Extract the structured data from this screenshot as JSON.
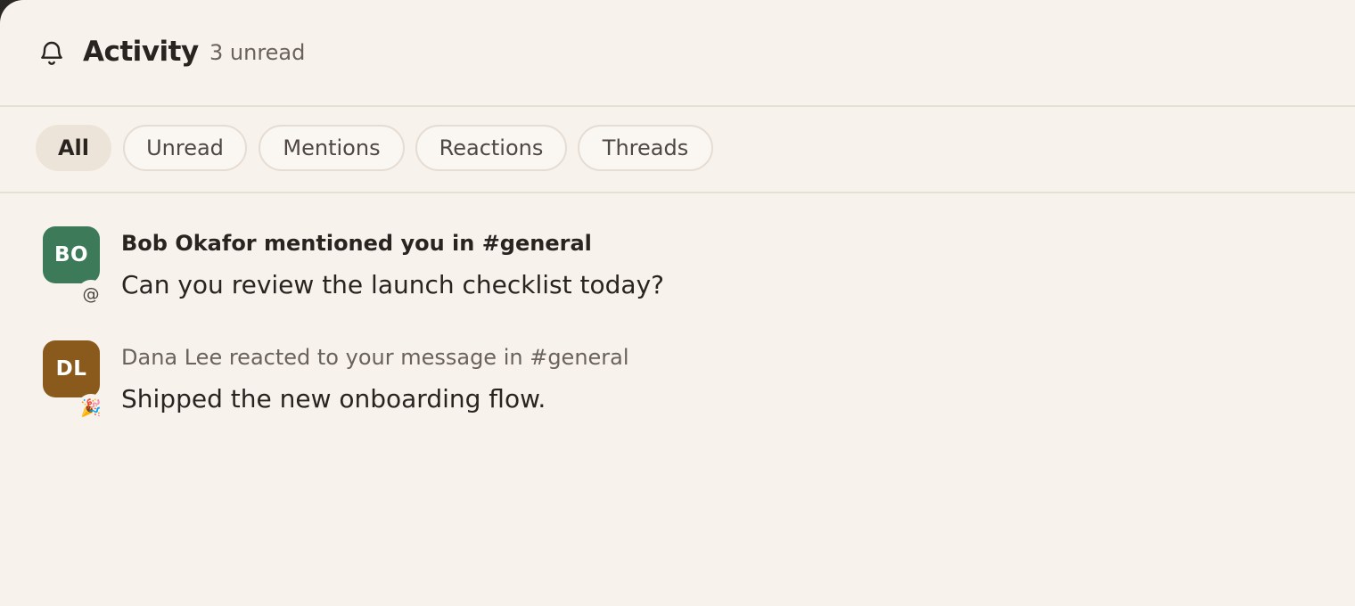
{
  "header": {
    "icon": "bell-icon",
    "title": "Activity",
    "unread_count": "3 unread"
  },
  "filters": [
    {
      "label": "All",
      "active": true
    },
    {
      "label": "Unread",
      "active": false
    },
    {
      "label": "Mentions",
      "active": false
    },
    {
      "label": "Reactions",
      "active": false
    },
    {
      "label": "Threads",
      "active": false
    }
  ],
  "activity": [
    {
      "initials": "BO",
      "avatar_color": "#3d7a5a",
      "badge": "@",
      "badge_icon": "mention-icon",
      "title": "Bob Okafor mentioned you in #general",
      "title_style": "unread",
      "body": "Can you review the launch checklist today?"
    },
    {
      "initials": "DL",
      "avatar_color": "#8a5a1c",
      "badge": "🎉",
      "badge_icon": "party-popper-icon",
      "title": "Dana Lee reacted to your message in #general",
      "title_style": "read",
      "body": "Shipped the new onboarding flow."
    }
  ],
  "colors": {
    "background": "#f7f2ec",
    "divider": "#e6e0d3",
    "text_primary": "#2a2420",
    "text_muted": "#6a625b",
    "chip_active_bg": "#ede4d9"
  }
}
